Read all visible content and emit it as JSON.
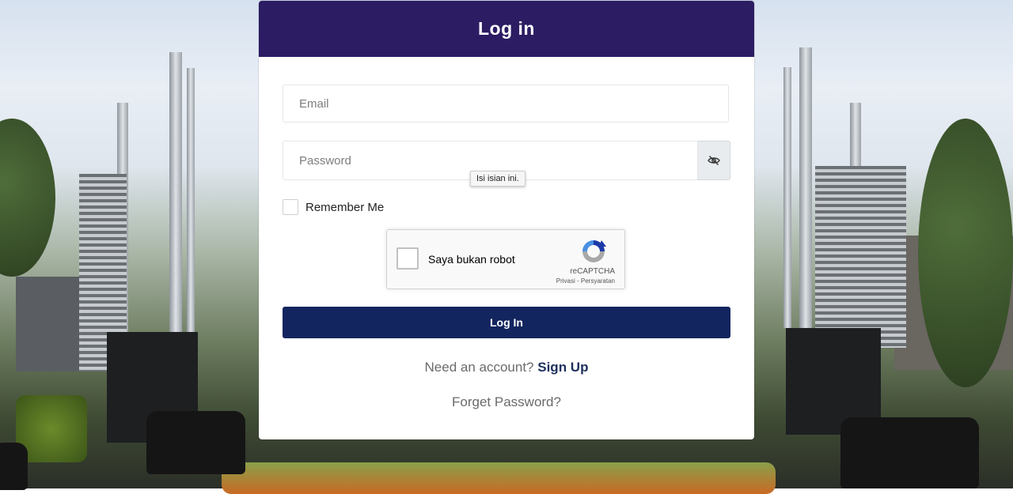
{
  "form": {
    "title": "Log in",
    "email_placeholder": "Email",
    "password_placeholder": "Password",
    "tooltip": "Isi isian ini.",
    "remember_label": "Remember Me",
    "submit_label": "Log In",
    "signup_prompt": "Need an account?",
    "signup_link": "Sign Up",
    "forgot_link": "Forget Password?"
  },
  "recaptcha": {
    "label": "Saya bukan robot",
    "brand": "reCAPTCHA",
    "links": "Privasi - Persyaratan"
  },
  "colors": {
    "header": "#2c1c63",
    "button": "#13255e",
    "link": "#1d2f5c"
  },
  "icons": {
    "password_toggle": "eye-off-icon",
    "recaptcha": "recaptcha-logo-icon"
  }
}
